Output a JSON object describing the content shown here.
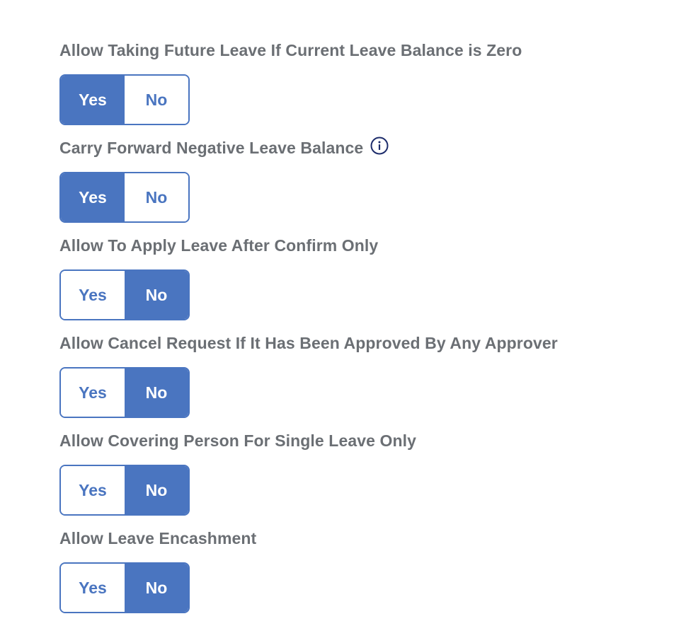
{
  "settings": [
    {
      "label": "Allow Taking Future Leave If Current Leave Balance is Zero",
      "yes_label": "Yes",
      "no_label": "No",
      "selected": "Yes",
      "has_info": false
    },
    {
      "label": "Carry Forward Negative Leave Balance",
      "yes_label": "Yes",
      "no_label": "No",
      "selected": "Yes",
      "has_info": true
    },
    {
      "label": "Allow To Apply Leave After Confirm Only",
      "yes_label": "Yes",
      "no_label": "No",
      "selected": "No",
      "has_info": false
    },
    {
      "label": "Allow Cancel Request If It Has Been Approved By Any Approver",
      "yes_label": "Yes",
      "no_label": "No",
      "selected": "No",
      "has_info": false
    },
    {
      "label": "Allow Covering Person For Single Leave Only",
      "yes_label": "Yes",
      "no_label": "No",
      "selected": "No",
      "has_info": false
    },
    {
      "label": "Allow Leave Encashment",
      "yes_label": "Yes",
      "no_label": "No",
      "selected": "No",
      "has_info": false
    }
  ],
  "icons": {
    "info": "info-circle-icon"
  },
  "colors": {
    "accent": "#4a75c0",
    "label": "#6b6f74",
    "info_icon": "#1d2c6b"
  }
}
